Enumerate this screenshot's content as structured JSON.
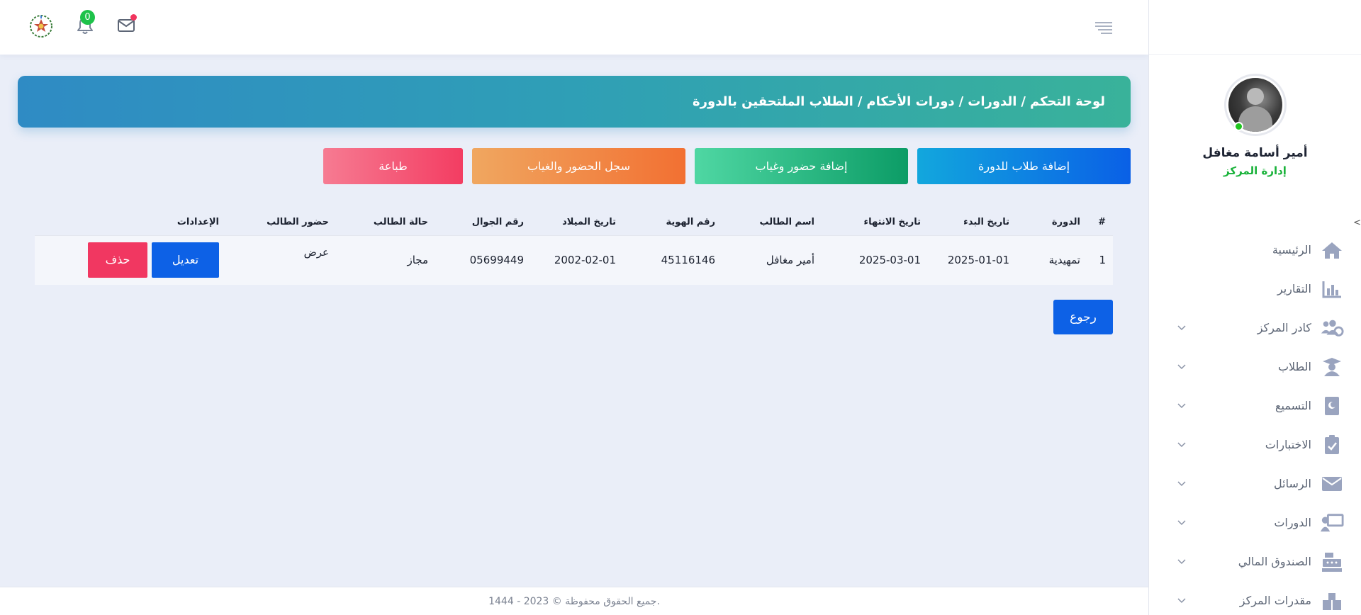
{
  "header": {
    "notification_count": "0"
  },
  "profile": {
    "name": "أمير أسامة مغافل",
    "role": "إدارة المركز"
  },
  "sidebar": {
    "collapse_glyph": "<",
    "items": [
      {
        "label": "الرئيسية",
        "icon": "home-icon",
        "has_chevron": false
      },
      {
        "label": "التقارير",
        "icon": "chart-icon",
        "has_chevron": false
      },
      {
        "label": "كادر المركز",
        "icon": "users-cog-icon",
        "has_chevron": true
      },
      {
        "label": "الطلاب",
        "icon": "graduate-icon",
        "has_chevron": true
      },
      {
        "label": "التسميع",
        "icon": "quran-icon",
        "has_chevron": true
      },
      {
        "label": "الاختبارات",
        "icon": "clipboard-check-icon",
        "has_chevron": true
      },
      {
        "label": "الرسائل",
        "icon": "envelope-icon",
        "has_chevron": true
      },
      {
        "label": "الدورات",
        "icon": "teacher-board-icon",
        "has_chevron": true
      },
      {
        "label": "الصندوق المالي",
        "icon": "cash-register-icon",
        "has_chevron": true
      },
      {
        "label": "مقدرات المركز",
        "icon": "warehouse-icon",
        "has_chevron": true
      }
    ]
  },
  "breadcrumb": {
    "items": [
      "لوحة التحكم",
      "الدورات",
      "دورات الأحكام"
    ],
    "current": "الطلاب الملتحقين بالدورة",
    "separator": "/"
  },
  "actions": {
    "add_students": "إضافة طلاب للدورة",
    "add_attendance": "إضافة حضور وغياب",
    "attendance_record": "سجل الحضور والغياب",
    "print": "طباعة"
  },
  "table": {
    "headers": [
      "#",
      "الدورة",
      "تاريخ البدء",
      "تاريخ الانتهاء",
      "اسم الطالب",
      "رقم الهوية",
      "تاريخ الميلاد",
      "رقم الجوال",
      "حالة الطالب",
      "حضور الطالب",
      "الإعدادات"
    ],
    "rows": [
      {
        "index": "1",
        "course": "تمهيدية",
        "start_date": "2025-01-01",
        "end_date": "2025-03-01",
        "student_name": "أمير مغافل",
        "id_number": "45116146",
        "birth_date": "2002-02-01",
        "mobile": "05699449",
        "status": "مجاز",
        "attendance_link": "عرض",
        "edit_label": "تعديل",
        "delete_label": "حذف"
      }
    ]
  },
  "back_label": "رجوع",
  "footer": {
    "text": "جميع الحقوق محفوظة © 2023 - 1444."
  },
  "colors": {
    "primary": "#0d61e6",
    "success": "#19b23a",
    "danger": "#f13761",
    "warning": "#e8a01d",
    "icon": "#9aa4bf"
  }
}
